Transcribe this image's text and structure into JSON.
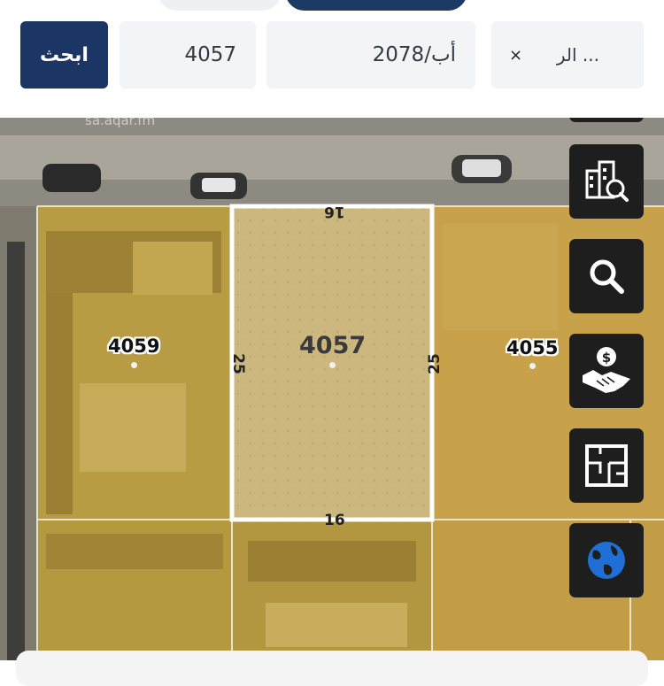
{
  "search": {
    "button_label": "ابحث",
    "plot_number": "4057",
    "plan_number": "2078/أب",
    "city": "الر ...",
    "clear_symbol": "×"
  },
  "map": {
    "watermark": "sa.aqar.fm",
    "selected_plot": {
      "number": "4057",
      "top_side": "16",
      "bottom_side": "16",
      "left_side": "25",
      "right_side": "25"
    },
    "neighbor_plots": [
      "4059",
      "4055"
    ]
  },
  "tools": [
    {
      "name": "building-search",
      "icon": "building-search-icon"
    },
    {
      "name": "search",
      "icon": "magnifier-icon"
    },
    {
      "name": "price-deal",
      "icon": "handshake-dollar-icon"
    },
    {
      "name": "floor-plan",
      "icon": "floor-plan-icon"
    },
    {
      "name": "globe",
      "icon": "globe-icon",
      "color": "#1f6fd6"
    }
  ],
  "colors": {
    "primary": "#1b3664",
    "plot_fill": "#c9a94a",
    "selected_outline": "#ffffff"
  }
}
